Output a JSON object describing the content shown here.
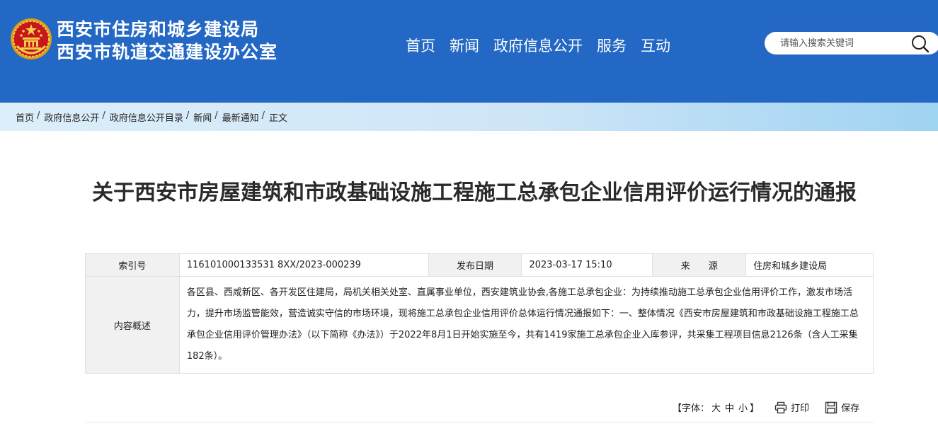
{
  "header": {
    "site_name_line1": "西安市住房和城乡建设局",
    "site_name_line2": "西安市轨道交通建设办公室",
    "nav": [
      {
        "label": "首页"
      },
      {
        "label": "新闻"
      },
      {
        "label": "政府信息公开"
      },
      {
        "label": "服务"
      },
      {
        "label": "互动"
      }
    ],
    "search": {
      "placeholder": "请输入搜索关键词",
      "icon": "search-icon"
    },
    "emblem_icon": "national-emblem-icon"
  },
  "breadcrumb": {
    "items": [
      "首页",
      "政府信息公开",
      "政府信息公开目录",
      "新闻",
      "最新通知",
      "正文"
    ],
    "separator": "/"
  },
  "article": {
    "title": "关于西安市房屋建筑和市政基础设施工程施工总承包企业信用评价运行情况的通报",
    "meta": {
      "index_label": "索引号",
      "index_value": "116101000133531 8XX/2023-000239",
      "date_label": "发布日期",
      "date_value": "2023-03-17 15:10",
      "source_label": "来　　源",
      "source_value": "住房和城乡建设局",
      "summary_label": "内容概述",
      "summary_value": "各区县、西咸新区、各开发区住建局，局机关相关处室、直属事业单位，西安建筑业协会,各施工总承包企业：为持续推动施工总承包企业信用评价工作，激发市场活力，提升市场监管能效，营造诚实守信的市场环境，现将施工总承包企业信用评价总体运行情况通报如下：一、整体情况《西安市房屋建筑和市政基础设施工程施工总承包企业信用评价管理办法》（以下简称《办法》）于2022年8月1日开始实施至今，共有1419家施工总承包企业入库参评，共采集工程项目信息2126条（含人工采集182条）。"
    }
  },
  "toolbar": {
    "font_prefix": "【字体：",
    "font_large": "大",
    "font_medium": "中",
    "font_small": "小",
    "font_suffix": "】",
    "print_label": "打印",
    "save_label": "保存",
    "print_icon": "printer-icon",
    "save_icon": "save-icon"
  },
  "colors": {
    "header_bg": "#2368c4",
    "breadcrumb_bg": "#cfe6f7",
    "meta_label_bg": "#f1f1f1"
  }
}
